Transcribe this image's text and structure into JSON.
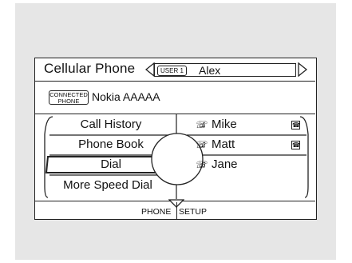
{
  "header": {
    "title": "Cellular Phone",
    "user_badge": "USER 1",
    "user_name": "Alex"
  },
  "connection": {
    "badge_line1": "CONNECTED",
    "badge_line2": "PHONE",
    "device_name": "Nokia AAAAA"
  },
  "menu": {
    "items": [
      "Call History",
      "Phone Book",
      "Dial",
      "More Speed Dial"
    ],
    "selected": "Dial"
  },
  "speed_dial": [
    {
      "index": "1",
      "name": "Mike",
      "has_phone_icon": true
    },
    {
      "index": "2",
      "name": "Matt",
      "has_phone_icon": true
    },
    {
      "index": "3",
      "name": "Jane",
      "has_phone_icon": false
    }
  ],
  "footer": {
    "left_label": "PHONE",
    "right_label": "SETUP"
  },
  "icons": {
    "left": "triangle-left-icon",
    "right": "triangle-right-icon",
    "down": "triangle-down-icon",
    "contact": "handset-icon",
    "phone": "phone-type-icon"
  }
}
